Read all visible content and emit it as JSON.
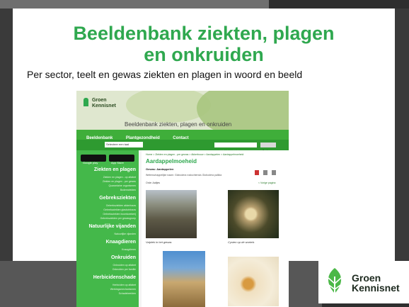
{
  "slide": {
    "title_line1": "Beeldenbank ziekten, plagen",
    "title_line2": "en onkruiden",
    "subtitle": "Per sector, teelt en gewas ziekten en plagen in woord en beeld"
  },
  "logo": {
    "line1": "Groen",
    "line2": "Kennisnet"
  },
  "website": {
    "logo_line1": "Groen",
    "logo_line2": "Kennisnet",
    "header_title": "Beeldenbank ziekten, plagen en onkruiden",
    "nav": [
      "Beeldenbank",
      "Plantgezondheid",
      "Contact"
    ],
    "language_select": "Selecteer een taal",
    "search_placeholder": "zoek* Aardappelziekten",
    "search_button": "Zoeken",
    "store_badges": [
      "Google play",
      "App Store"
    ],
    "sidebar": [
      {
        "heading": "Ziekten en plagen",
        "links": [
          "Ziekten en plagen - op alfabet",
          "Ziekten en plagen - per gewas",
          "Quarantaine organismen",
          "Bodemziekten"
        ]
      },
      {
        "heading": "Gebreksziekten",
        "links": [
          "Gebreksziekten akkerbouw",
          "Gebreksziekten glastuinbouw",
          "Gebreksziekten boomkwekerij",
          "Gebreksziekten per gewasgroep"
        ]
      },
      {
        "heading": "Natuurlijke vijanden",
        "links": [
          "Natuurlijke vijanden"
        ]
      },
      {
        "heading": "Knaagdieren",
        "links": [
          "Knaagdieren"
        ]
      },
      {
        "heading": "Onkruiden",
        "links": [
          "Onkruiden op alfabet",
          "Onkruiden per familie"
        ]
      },
      {
        "heading": "Herbicidenschade",
        "links": [
          "Herbiciden op alfabet",
          "Werkingsmechanismen",
          "Schadebeelden"
        ]
      }
    ],
    "breadcrumb": "Home > Ziekten en plagen - per gewas > Akkerbouw > Aardappelen > Aardappelmoeheid",
    "main_heading": "Aardappelmoeheid",
    "gewas": "Gewas: Aardappelen",
    "latin": "Wetenschappelijke naam: Globodera rostochiensis Globodera pallida",
    "order": "Orde: Aaltjes",
    "back_link": "< Vorige pagina",
    "photo_captions": [
      "Valplek in het gewas",
      "Cysten op de wortels"
    ]
  }
}
